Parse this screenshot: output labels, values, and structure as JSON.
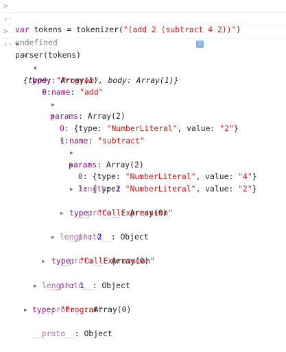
{
  "console": {
    "entries": [
      {
        "input_prefix": "var ",
        "input_ident": "tokens = tokenizer(",
        "input_str": "\"(add 2 (subtract 4 2))\"",
        "input_suffix": ")"
      },
      {
        "result": "undefined"
      },
      {
        "input": "parser(tokens)"
      }
    ],
    "tree": {
      "root": {
        "type_key": "type",
        "type_val": "\"Program\"",
        "body_key": "body",
        "body_val": "Array(1)"
      },
      "lines": {
        "l1": {
          "key": "body",
          "val": "Array(1)"
        },
        "l2": {
          "key": "0"
        },
        "l3": {
          "key": "name",
          "val": "\"add\""
        },
        "l4": {
          "key": "params",
          "val": "Array(2)"
        },
        "l5": {
          "key": "0",
          "summary_pre": "{type: ",
          "summary_type": "\"NumberLiteral\"",
          "summary_mid": ", value: ",
          "summary_val": "\"2\"",
          "summary_post": "}"
        },
        "l6": {
          "key": "1"
        },
        "l7": {
          "key": "name",
          "val": "\"subtract\""
        },
        "l8": {
          "key": "params",
          "val": "Array(2)"
        },
        "l9": {
          "key": "0",
          "summary_pre": "{type: ",
          "summary_type": "\"NumberLiteral\"",
          "summary_mid": ", value: ",
          "summary_val": "\"4\"",
          "summary_post": "}"
        },
        "l10": {
          "key": "1",
          "summary_pre": "{type: ",
          "summary_type": "\"NumberLiteral\"",
          "summary_mid": ", value: ",
          "summary_val": "\"2\"",
          "summary_post": "}"
        },
        "l11": {
          "key": "length",
          "val": "2"
        },
        "l12": {
          "key": "__proto__",
          "val": "Array(0)"
        },
        "l13": {
          "key": "type",
          "val": "\"CallExpression\""
        },
        "l14": {
          "key": "__proto__",
          "val": "Object"
        },
        "l15": {
          "key": "length",
          "val": "2"
        },
        "l16": {
          "key": "__proto__",
          "val": "Array(0)"
        },
        "l17": {
          "key": "type",
          "val": "\"CallExpression\""
        },
        "l18": {
          "key": "__proto__",
          "val": "Object"
        },
        "l19": {
          "key": "length",
          "val": "1"
        },
        "l20": {
          "key": "__proto__",
          "val": "Array(0)"
        },
        "l21": {
          "key": "type",
          "val": "\"Program\""
        },
        "l22": {
          "key": "__proto__",
          "val": "Object"
        }
      }
    },
    "icons": {
      "expanded": "triangle-down",
      "collapsed": "triangle-right",
      "info": "i"
    }
  }
}
